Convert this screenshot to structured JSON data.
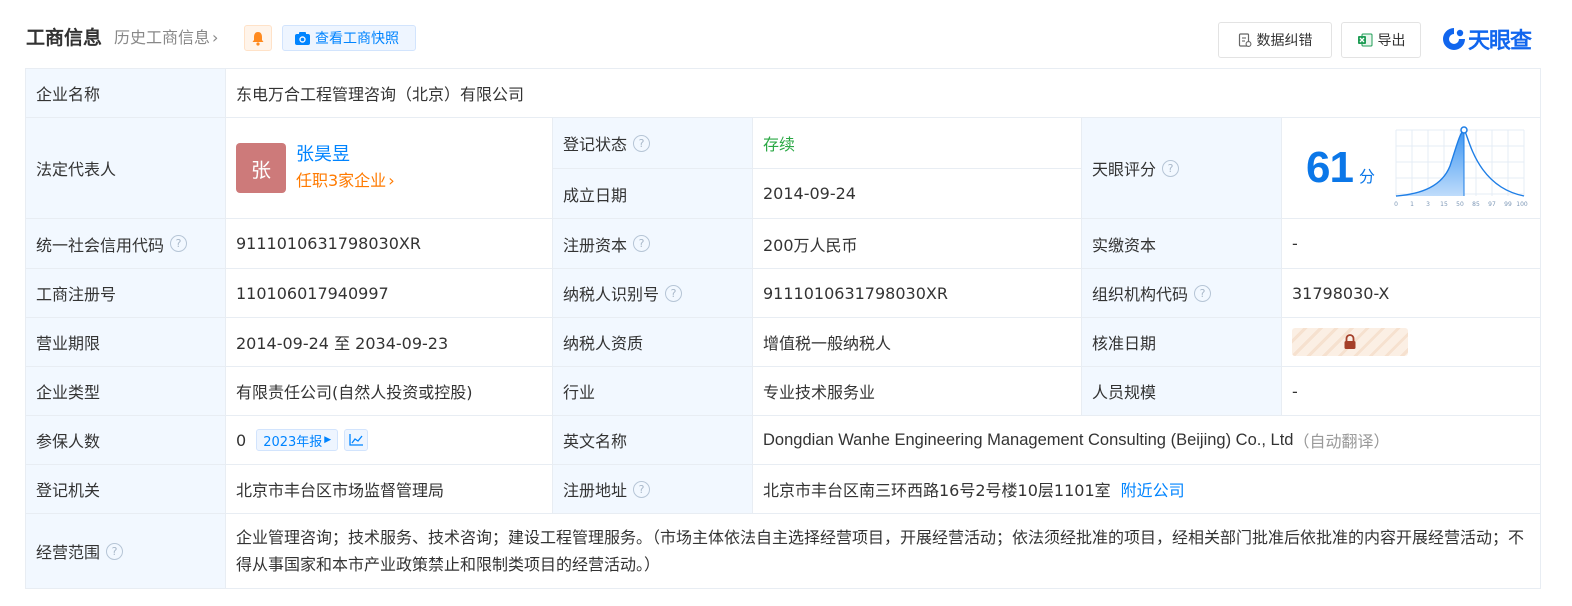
{
  "header": {
    "title": "工商信息",
    "history": "历史工商信息",
    "snapshot": "查看工商快照",
    "correction": "数据纠错",
    "export": "导出",
    "logo_text": "天眼查"
  },
  "labels": {
    "company_name": "企业名称",
    "legal_rep": "法定代表人",
    "reg_status": "登记状态",
    "founded": "成立日期",
    "score": "天眼评分",
    "credit_code": "统一社会信用代码",
    "reg_capital": "注册资本",
    "paid_capital": "实缴资本",
    "biz_reg_no": "工商注册号",
    "taxpayer_id": "纳税人识别号",
    "org_code": "组织机构代码",
    "biz_term": "营业期限",
    "taxpayer_quality": "纳税人资质",
    "approval_date": "核准日期",
    "company_type": "企业类型",
    "industry": "行业",
    "staff_size": "人员规模",
    "insured": "参保人数",
    "english_name": "英文名称",
    "reg_authority": "登记机关",
    "reg_address": "注册地址",
    "biz_scope": "经营范围"
  },
  "values": {
    "company_name": "东电万合工程管理咨询（北京）有限公司",
    "legal_rep_avatar": "张",
    "legal_rep_name": "张昊昱",
    "legal_rep_sub": "任职3家企业",
    "reg_status": "存续",
    "founded": "2014-09-24",
    "score": "61",
    "score_unit": "分",
    "credit_code": "9111010631798030XR",
    "reg_capital": "200万人民币",
    "paid_capital": "-",
    "biz_reg_no": "110106017940997",
    "taxpayer_id": "9111010631798030XR",
    "org_code": "31798030-X",
    "biz_term": "2014-09-24 至 2034-09-23",
    "taxpayer_quality": "增值税一般纳税人",
    "company_type": "有限责任公司(自然人投资或控股)",
    "industry": "专业技术服务业",
    "staff_size": "-",
    "insured": "0",
    "insured_tag": "2023年报",
    "english_name": "Dongdian Wanhe Engineering Management Consulting (Beijing) Co., Ltd",
    "english_note": "（自动翻译）",
    "reg_authority": "北京市丰台区市场监督管理局",
    "reg_address": "北京市丰台区南三环西路16号2号楼10层1101室",
    "nearby": "附近公司",
    "biz_scope": "企业管理咨询；技术服务、技术咨询；建设工程管理服务。（市场主体依法自主选择经营项目，开展经营活动；依法须经批准的项目，经相关部门批准后依批准的内容开展经营活动；不得从事国家和本市产业政策禁止和限制类项目的经营活动。）"
  },
  "score_chart": {
    "ticks": [
      "0",
      "1",
      "3",
      "15",
      "50",
      "85",
      "97",
      "99",
      "100"
    ]
  },
  "colors": {
    "accent": "#0084ff",
    "orange": "#ff7a00",
    "green": "#2aa844",
    "label_bg": "#f2f8ff"
  }
}
